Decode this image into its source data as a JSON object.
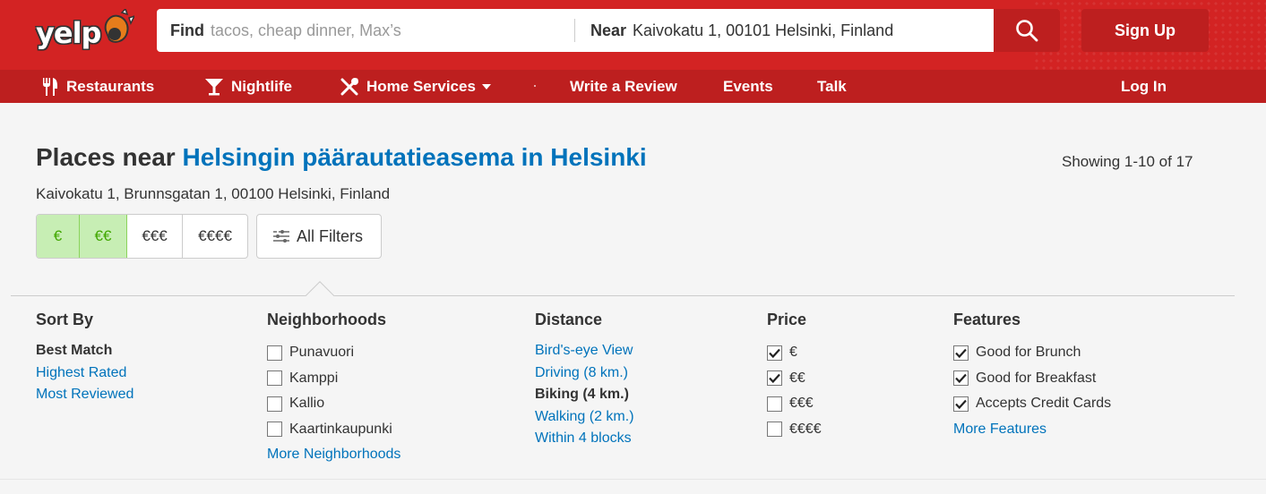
{
  "header": {
    "logo_text": "yelp",
    "search": {
      "find_label": "Find",
      "find_placeholder": "tacos, cheap dinner, Max’s",
      "near_label": "Near",
      "near_value": "Kaivokatu 1, 00101 Helsinki, Finland"
    },
    "signup_label": "Sign Up",
    "brand_color": "#d32323"
  },
  "nav": {
    "restaurants": "Restaurants",
    "nightlife": "Nightlife",
    "home_services": "Home Services",
    "write_review": "Write a Review",
    "events": "Events",
    "talk": "Talk",
    "login": "Log In"
  },
  "main": {
    "title_bold": "Places",
    "title_near": "near",
    "title_link": "Helsingin päärautatieasema in Helsinki",
    "showing": "Showing 1-10 of 17",
    "address": "Kaivokatu 1, Brunnsgatan 1, 00100 Helsinki, Finland",
    "price_buttons": [
      {
        "label": "€",
        "selected": true
      },
      {
        "label": "€€",
        "selected": true
      },
      {
        "label": "€€€",
        "selected": false
      },
      {
        "label": "€€€€",
        "selected": false
      }
    ],
    "all_filters": "All Filters"
  },
  "filters": {
    "sort_by": {
      "heading": "Sort By",
      "options": [
        "Best Match",
        "Highest Rated",
        "Most Reviewed"
      ],
      "active": "Best Match"
    },
    "neighborhoods": {
      "heading": "Neighborhoods",
      "items": [
        {
          "label": "Punavuori",
          "checked": false
        },
        {
          "label": "Kamppi",
          "checked": false
        },
        {
          "label": "Kallio",
          "checked": false
        },
        {
          "label": "Kaartinkaupunki",
          "checked": false
        }
      ],
      "more": "More Neighborhoods"
    },
    "distance": {
      "heading": "Distance",
      "options": [
        "Bird's-eye View",
        "Driving (8 km.)",
        "Biking (4 km.)",
        "Walking (2 km.)",
        "Within 4 blocks"
      ],
      "active": "Biking (4 km.)"
    },
    "price": {
      "heading": "Price",
      "items": [
        {
          "label": "€",
          "checked": true
        },
        {
          "label": "€€",
          "checked": true
        },
        {
          "label": "€€€",
          "checked": false
        },
        {
          "label": "€€€€",
          "checked": false
        }
      ]
    },
    "features": {
      "heading": "Features",
      "items": [
        {
          "label": "Good for Brunch",
          "checked": true
        },
        {
          "label": "Good for Breakfast",
          "checked": true
        },
        {
          "label": "Accepts Credit Cards",
          "checked": true
        }
      ],
      "more": "More Features"
    }
  }
}
